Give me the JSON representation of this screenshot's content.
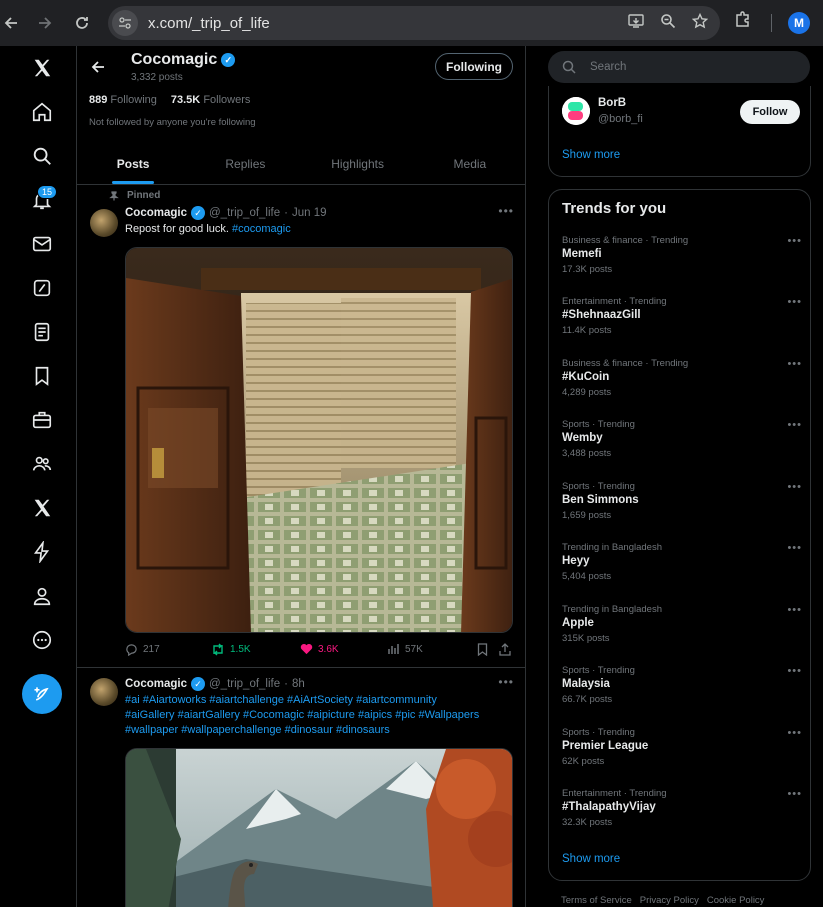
{
  "browser": {
    "url": "x.com/_trip_of_life",
    "profile_initial": "M"
  },
  "nav": {
    "notifications_badge": "15"
  },
  "profile": {
    "name": "Cocomagic",
    "post_count": "3,332 posts",
    "following_button": "Following",
    "following_count": "889",
    "following_label": "Following",
    "followers_count": "73.5K",
    "followers_label": "Followers",
    "not_followed_note": "Not followed by anyone you're following"
  },
  "tabs": [
    "Posts",
    "Replies",
    "Highlights",
    "Media"
  ],
  "posts": [
    {
      "pinned_label": "Pinned",
      "name": "Cocomagic",
      "handle": "@_trip_of_life",
      "time": "Jun 19",
      "text": "Repost for good luck.",
      "hashtag": "#cocomagic",
      "replies": "217",
      "reposts": "1.5K",
      "likes": "3.6K",
      "views": "57K"
    },
    {
      "name": "Cocomagic",
      "handle": "@_trip_of_life",
      "time": "8h",
      "hashtags_line1": "#ai #Aiartoworks #aiartchallenge #AiArtSociety #aiartcommunity",
      "hashtags_line2": "#aiGallery #aiartGallery #Cocomagic #aipicture #aipics #pic #Wallpapers",
      "hashtags_line3": "#wallpaper #wallpaperchallenge #dinosaur #dinosaurs"
    }
  ],
  "right": {
    "search_placeholder": "Search",
    "who_to_follow": {
      "name": "BorB",
      "handle": "@borb_fi",
      "button": "Follow",
      "show_more": "Show more"
    },
    "trends_title": "Trends for you",
    "trends": [
      {
        "context": "Business & finance · Trending",
        "title": "Memefi",
        "count": "17.3K posts"
      },
      {
        "context": "Entertainment · Trending",
        "title": "#ShehnaazGill",
        "count": "11.4K posts"
      },
      {
        "context": "Business & finance · Trending",
        "title": "#KuCoin",
        "count": "4,289 posts"
      },
      {
        "context": "Sports · Trending",
        "title": "Wemby",
        "count": "3,488 posts"
      },
      {
        "context": "Sports · Trending",
        "title": "Ben Simmons",
        "count": "1,659 posts"
      },
      {
        "context": "Trending in Bangladesh",
        "title": "Heyy",
        "count": "5,404 posts"
      },
      {
        "context": "Trending in Bangladesh",
        "title": "Apple",
        "count": "315K posts"
      },
      {
        "context": "Sports · Trending",
        "title": "Malaysia",
        "count": "66.7K posts"
      },
      {
        "context": "Sports · Trending",
        "title": "Premier League",
        "count": "62K posts"
      },
      {
        "context": "Entertainment · Trending",
        "title": "#ThalapathyVijay",
        "count": "32.3K posts"
      }
    ],
    "trends_show_more": "Show more",
    "footer": [
      "Terms of Service",
      "Privacy Policy",
      "Cookie Policy"
    ]
  },
  "colors": {
    "accent": "#1d9bf0",
    "like": "#f91880",
    "repost": "#00ba7c",
    "border": "#2f3336",
    "muted": "#71767b"
  }
}
